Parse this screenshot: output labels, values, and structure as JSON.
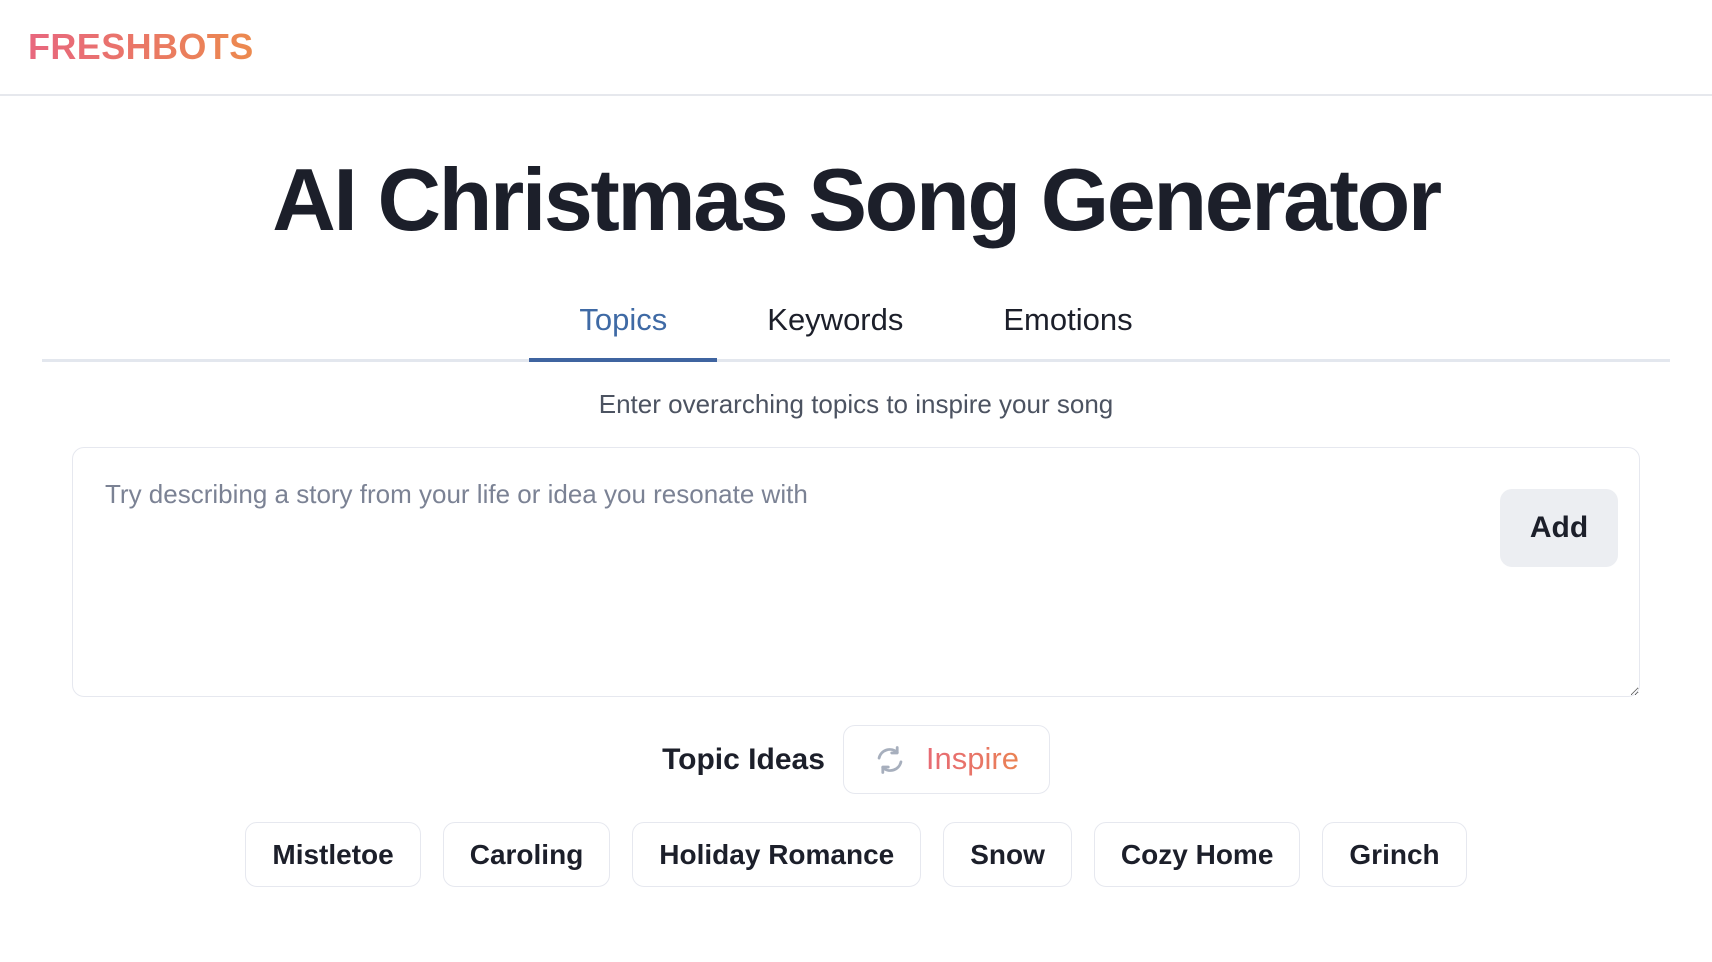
{
  "header": {
    "brand": "FRESHBOTS",
    "brand_gradient_from": "#e8677e",
    "brand_gradient_to": "#ec8a4e"
  },
  "main": {
    "title": "AI Christmas Song Generator",
    "tabs": [
      {
        "label": "Topics",
        "active": true
      },
      {
        "label": "Keywords",
        "active": false
      },
      {
        "label": "Emotions",
        "active": false
      }
    ],
    "active_tab_color": "#3f6aa5",
    "active_tab_underline_color": "#3f64a0",
    "subtitle": "Enter overarching topics to inspire your song",
    "input": {
      "value": "",
      "placeholder": "Try describing a story from your life or idea you resonate with"
    },
    "add_button": {
      "label": "Add",
      "background": "#eceef2"
    },
    "ideas": {
      "label": "Topic Ideas",
      "inspire_label": "Inspire",
      "inspire_icon": "refresh-icon",
      "inspire_icon_color": "#a7afbd",
      "inspire_gradient_from": "#e76a74",
      "inspire_gradient_to": "#ea8352"
    },
    "chips": [
      {
        "label": "Mistletoe"
      },
      {
        "label": "Caroling"
      },
      {
        "label": "Holiday Romance"
      },
      {
        "label": "Snow"
      },
      {
        "label": "Cozy Home"
      },
      {
        "label": "Grinch"
      }
    ]
  }
}
